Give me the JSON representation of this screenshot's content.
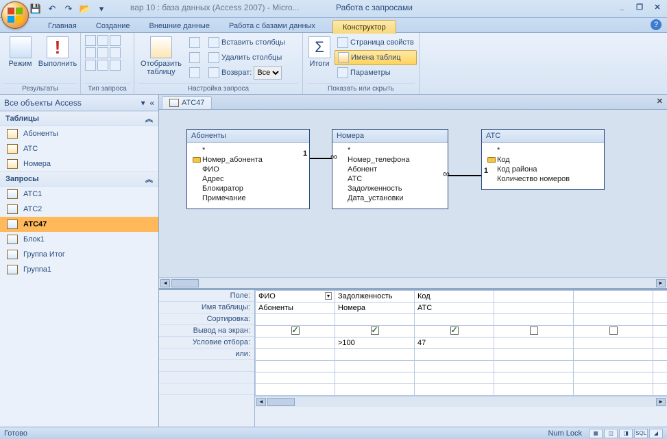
{
  "title": "вар 10 : база данных (Access 2007) - Micro...",
  "context_title": "Работа с запросами",
  "quick_access": {
    "save": "💾",
    "undo": "↶",
    "redo": "↷",
    "open": "📂"
  },
  "win": {
    "min": "_",
    "max": "❐",
    "close": "✕"
  },
  "ribbon_tabs": {
    "t1": "Главная",
    "t2": "Создание",
    "t3": "Внешние данные",
    "t4": "Работа с базами данных",
    "t5": "Конструктор"
  },
  "ribbon": {
    "g1_label": "Результаты",
    "mode": "Режим",
    "run": "Выполнить",
    "g2_label": "Тип запроса",
    "g3_label": "Настройка запроса",
    "show_table": "Отобразить таблицу",
    "insert_cols": "Вставить столбцы",
    "delete_cols": "Удалить столбцы",
    "return": "Возврат:",
    "return_val": "Все",
    "g4_label": "Показать или скрыть",
    "totals": "Итоги",
    "prop_sheet": "Страница свойств",
    "table_names": "Имена таблиц",
    "params": "Параметры"
  },
  "nav": {
    "header": "Все объекты Access",
    "grp_tables": "Таблицы",
    "grp_queries": "Запросы",
    "tables": {
      "t1": "Абоненты",
      "t2": "АТС",
      "t3": "Номера"
    },
    "queries": {
      "q1": "АТС1",
      "q2": "АТС2",
      "q3": "АТС47",
      "q4": "Блок1",
      "q5": "Группа Итог",
      "q6": "Группа1"
    }
  },
  "doc_tab": "АТС47",
  "tables": {
    "t1": {
      "title": "Абоненты",
      "star": "*",
      "f1": "Номер_абонента",
      "f2": "ФИО",
      "f3": "Адрес",
      "f4": "Блокиратор",
      "f5": "Примечание"
    },
    "t2": {
      "title": "Номера",
      "star": "*",
      "f1": "Номер_телефона",
      "f2": "Абонент",
      "f3": "АТС",
      "f4": "Задолженность",
      "f5": "Дата_установки"
    },
    "t3": {
      "title": "АТС",
      "star": "*",
      "f1": "Код",
      "f2": "Код района",
      "f3": "Количество номеров"
    }
  },
  "rel": {
    "one": "1",
    "inf": "∞"
  },
  "qbe_labels": {
    "l1": "Поле:",
    "l2": "Имя таблицы:",
    "l3": "Сортировка:",
    "l4": "Вывод на экран:",
    "l5": "Условие отбора:",
    "l6": "или:"
  },
  "qbe": {
    "c1": {
      "field": "ФИО",
      "table": "Абоненты",
      "show": true,
      "crit": ""
    },
    "c2": {
      "field": "Задолженность",
      "table": "Номера",
      "show": true,
      "crit": ">100"
    },
    "c3": {
      "field": "Код",
      "table": "АТС",
      "show": true,
      "crit": "47"
    }
  },
  "status": {
    "ready": "Готово",
    "numlock": "Num Lock",
    "sql": "SQL"
  }
}
